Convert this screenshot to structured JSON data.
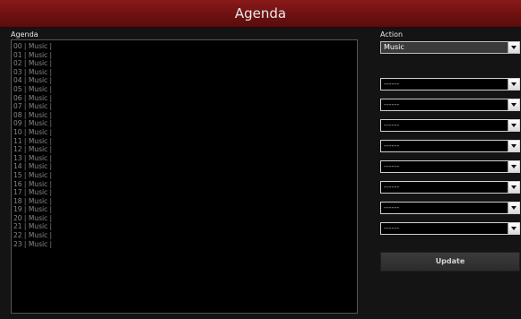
{
  "window": {
    "title": "Agenda"
  },
  "agenda": {
    "label": "Agenda",
    "lines": [
      "00 | Music |",
      "01 | Music |",
      "02 | Music |",
      "03 | Music |",
      "04 | Music |",
      "05 | Music |",
      "06 | Music |",
      "07 | Music |",
      "08 | Music |",
      "09 | Music |",
      "10 | Music |",
      "11 | Music |",
      "12 | Music |",
      "13 | Music |",
      "14 | Music |",
      "15 | Music |",
      "16 | Music |",
      "17 | Music |",
      "18 | Music |",
      "19 | Music |",
      "20 | Music |",
      "21 | Music |",
      "22 | Music |",
      "23 | Music |"
    ]
  },
  "action": {
    "label": "Action",
    "selects": [
      "Music",
      "------",
      "------",
      "------",
      "------",
      "------",
      "------",
      "------",
      "------"
    ]
  },
  "update_label": "Update",
  "colors": {
    "title_bar": "#7a1414",
    "background": "#141414"
  }
}
